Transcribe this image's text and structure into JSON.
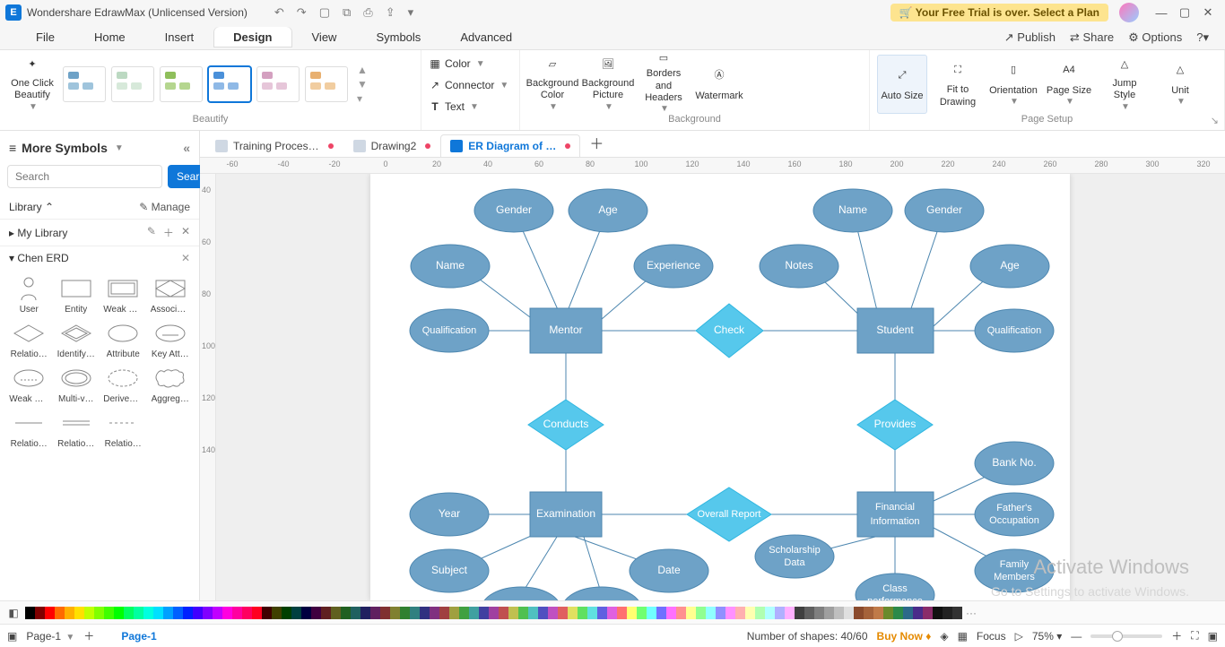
{
  "app": {
    "title": "Wondershare EdrawMax (Unlicensed Version)",
    "trial_banner": "Your Free Trial is over. Select a Plan"
  },
  "menu": {
    "items": [
      "File",
      "Home",
      "Insert",
      "Design",
      "View",
      "Symbols",
      "Advanced"
    ],
    "active": "Design",
    "right": {
      "publish": "Publish",
      "share": "Share",
      "options": "Options"
    }
  },
  "ribbon": {
    "beautify_label": "Beautify",
    "one_click": "One Click Beautify",
    "color": "Color",
    "connector": "Connector",
    "text": "Text",
    "background_label": "Background",
    "bg_color": "Background Color",
    "bg_picture": "Background Picture",
    "borders_headers": "Borders and Headers",
    "watermark": "Watermark",
    "page_setup_label": "Page Setup",
    "auto_size": "Auto Size",
    "fit_drawing": "Fit to Drawing",
    "orientation": "Orientation",
    "page_size": "Page Size",
    "jump_style": "Jump Style",
    "unit": "Unit"
  },
  "left": {
    "more_symbols": "More Symbols",
    "search_placeholder": "Search",
    "search_btn": "Search",
    "library": "Library",
    "manage": "Manage",
    "my_library": "My Library",
    "chen_erd": "Chen ERD",
    "shapes": [
      "User",
      "Entity",
      "Weak E…",
      "Associa…",
      "Relatio…",
      "Identify…",
      "Attribute",
      "Key Att…",
      "Weak K…",
      "Multi-v…",
      "Derived…",
      "Aggreg…",
      "Relatio…",
      "Relatio…",
      "Relatio…"
    ]
  },
  "tabs": [
    {
      "label": "Training Proces…",
      "active": false,
      "dirty": true
    },
    {
      "label": "Drawing2",
      "active": false,
      "dirty": true
    },
    {
      "label": "ER Diagram of …",
      "active": true,
      "dirty": true
    }
  ],
  "ruler_h": [
    "-60",
    "-40",
    "-20",
    "0",
    "20",
    "40",
    "60",
    "80",
    "100",
    "120",
    "140",
    "160",
    "180",
    "200",
    "220",
    "240",
    "260",
    "280",
    "300",
    "320"
  ],
  "ruler_v": [
    "40",
    "60",
    "80",
    "100",
    "120",
    "140"
  ],
  "erd": {
    "entities": {
      "mentor": "Mentor",
      "student": "Student",
      "examination": "Examination",
      "fin_info": "Financial Information"
    },
    "relationships": {
      "check": "Check",
      "conducts": "Conducts",
      "provides": "Provides",
      "overall_report": "Overall Report"
    },
    "attributes": {
      "m_gender": "Gender",
      "m_age": "Age",
      "m_name": "Name",
      "m_experience": "Experience",
      "m_qualification": "Qualification",
      "s_name": "Name",
      "s_gender": "Gender",
      "s_notes": "Notes",
      "s_age": "Age",
      "s_qualification": "Qualification",
      "e_year": "Year",
      "e_subject": "Subject",
      "e_date": "Date",
      "f_bank_no": "Bank No.",
      "f_father_occ": "Father's Occupation",
      "f_family": "Family Members",
      "f_scholarship": "Scholarship Data",
      "f_class_perf": "Class performance"
    }
  },
  "status": {
    "page_name": "Page-1",
    "page_link": "Page-1",
    "shapes": "Number of shapes: 40/60",
    "buy_now": "Buy Now",
    "focus": "Focus",
    "zoom": "75%"
  },
  "watermark": {
    "line1": "Activate Windows",
    "line2": "Go to Settings to activate Windows."
  },
  "colors": [
    "#000000",
    "#7f0000",
    "#ff0000",
    "#ff6a00",
    "#ffb000",
    "#ffe000",
    "#c0ff00",
    "#80ff00",
    "#40ff00",
    "#00ff00",
    "#00ff60",
    "#00ffa0",
    "#00ffe0",
    "#00e0ff",
    "#00a0ff",
    "#0060ff",
    "#0020ff",
    "#4000ff",
    "#8000ff",
    "#c000ff",
    "#ff00e0",
    "#ff00a0",
    "#ff0060",
    "#ff0020",
    "#400000",
    "#404000",
    "#004000",
    "#004040",
    "#000040",
    "#400040",
    "#602020",
    "#606020",
    "#206020",
    "#206060",
    "#202060",
    "#602060",
    "#803030",
    "#808030",
    "#308030",
    "#308080",
    "#303080",
    "#803080",
    "#a04040",
    "#a0a040",
    "#40a040",
    "#40a0a0",
    "#4040a0",
    "#a040a0",
    "#c05050",
    "#c0c050",
    "#50c050",
    "#50c0c0",
    "#5050c0",
    "#c050c0",
    "#e06060",
    "#e0e060",
    "#60e060",
    "#60e0e0",
    "#6060e0",
    "#e060e0",
    "#ff7070",
    "#ffff70",
    "#70ff70",
    "#70ffff",
    "#7070ff",
    "#ff70ff",
    "#ff9090",
    "#ffff90",
    "#90ff90",
    "#90ffff",
    "#9090ff",
    "#ff90ff",
    "#ffb0b0",
    "#ffffb0",
    "#b0ffb0",
    "#b0ffff",
    "#b0b0ff",
    "#ffb0ff",
    "#3f3f3f",
    "#5f5f5f",
    "#7f7f7f",
    "#9f9f9f",
    "#bfbfbf",
    "#dfdfdf",
    "#8a4a2c",
    "#a5623a",
    "#c07a48",
    "#6a8a2c",
    "#2c8a4a",
    "#2c6a8a",
    "#4a2c8a",
    "#8a2c6a",
    "#111",
    "#222",
    "#333"
  ]
}
